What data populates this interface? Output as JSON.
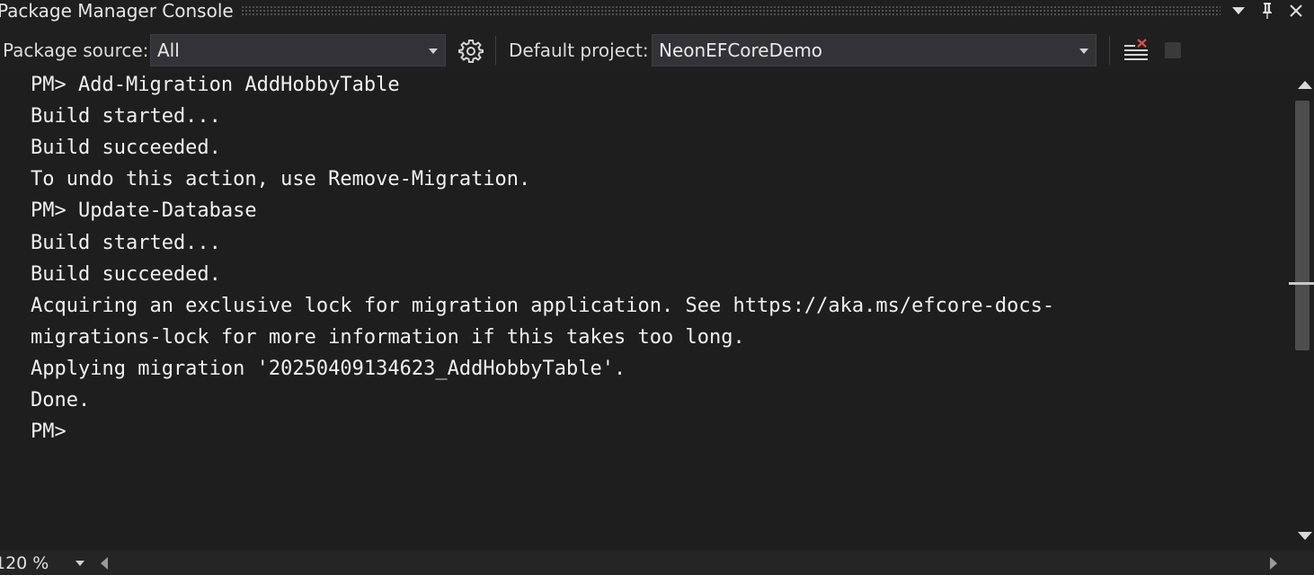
{
  "window": {
    "title": "Package Manager Console",
    "buttons": [
      "dropdown",
      "pin",
      "close"
    ]
  },
  "toolbar": {
    "package_source_label": "Package source:",
    "package_source_value": "All",
    "settings_icon": "gear-icon",
    "default_project_label": "Default project:",
    "default_project_value": "NeonEFCoreDemo",
    "clear_icon": "clear-console-icon",
    "stop_icon": "stop-icon"
  },
  "console": {
    "lines": [
      "PM> Add-Migration AddHobbyTable",
      "Build started...",
      "Build succeeded.",
      "To undo this action, use Remove-Migration.",
      "PM> Update-Database",
      "Build started...",
      "Build succeeded.",
      "Acquiring an exclusive lock for migration application. See https://aka.ms/efcore-docs-",
      "migrations-lock for more information if this takes too long.",
      "Applying migration '20250409134623_AddHobbyTable'.",
      "Done.",
      "PM>"
    ]
  },
  "status": {
    "zoom": "120 %"
  }
}
